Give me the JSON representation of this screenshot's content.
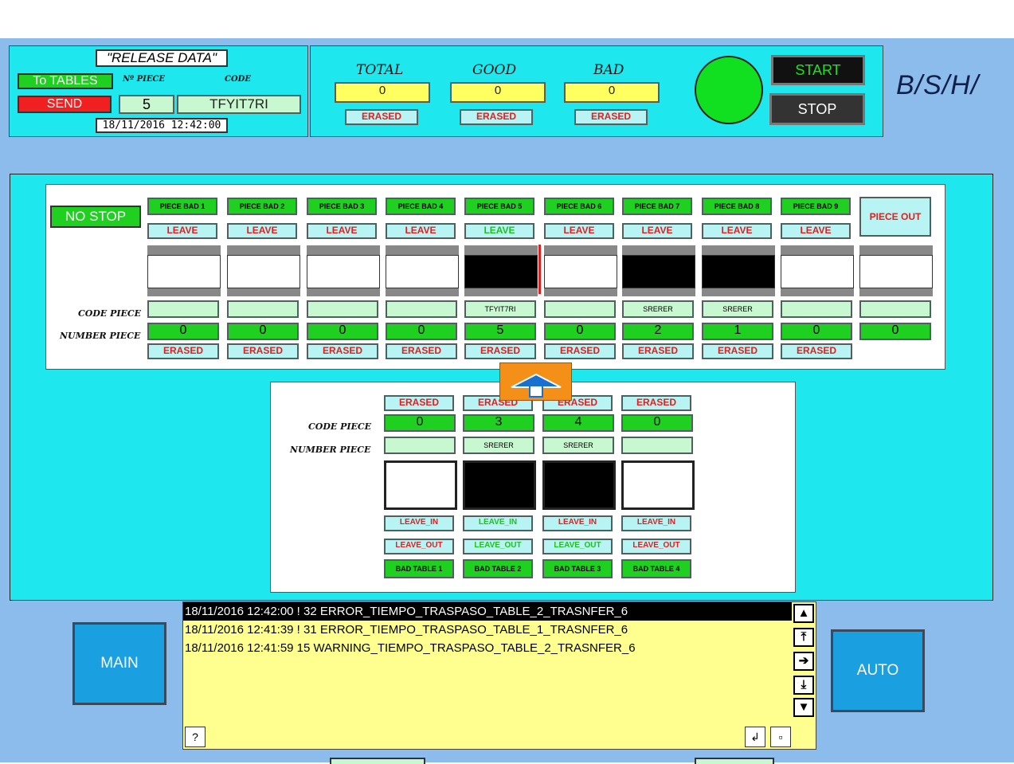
{
  "release": {
    "title": "\"RELEASE DATA\"",
    "to_tables_label": "To TABLES",
    "send_label": "SEND",
    "piece_no_label": "Nº PIECE",
    "code_label": "CODE",
    "piece_no_value": "5",
    "code_value": "TFYIT7RI",
    "datetime": "18/11/2016 12:42:00"
  },
  "counters": {
    "total_label": "TOTAL",
    "good_label": "GOOD",
    "bad_label": "BAD",
    "total_value": "0",
    "good_value": "0",
    "bad_value": "0",
    "erased_label": "ERASED"
  },
  "controls": {
    "start_label": "START",
    "stop_label": "STOP",
    "status_color": "#10e020"
  },
  "logo": "B/S/H/",
  "tables": {
    "no_stop_label": "NO STOP",
    "piece_out_label": "PIECE OUT",
    "code_piece_label": "CODE PIECE",
    "number_piece_label": "NUMBER PIECE",
    "erased_label": "ERASED",
    "columns": [
      {
        "bad_label": "PIECE BAD 1",
        "leave_label": "LEAVE",
        "slot": "empty",
        "code": "",
        "number": "0"
      },
      {
        "bad_label": "PIECE BAD 2",
        "leave_label": "LEAVE",
        "slot": "empty",
        "code": "",
        "number": "0"
      },
      {
        "bad_label": "PIECE BAD 3",
        "leave_label": "LEAVE",
        "slot": "empty",
        "code": "",
        "number": "0"
      },
      {
        "bad_label": "PIECE BAD 4",
        "leave_label": "LEAVE",
        "slot": "empty",
        "code": "",
        "number": "0"
      },
      {
        "bad_label": "PIECE BAD 5",
        "leave_label": "LEAVE",
        "slot": "occupied",
        "code": "TFYIT7RI",
        "number": "5"
      },
      {
        "bad_label": "PIECE BAD 6",
        "leave_label": "LEAVE",
        "slot": "empty",
        "code": "",
        "number": "0"
      },
      {
        "bad_label": "PIECE BAD 7",
        "leave_label": "LEAVE",
        "slot": "occupied",
        "code": "SRERER",
        "number": "2"
      },
      {
        "bad_label": "PIECE BAD 8",
        "leave_label": "LEAVE",
        "slot": "occupied",
        "code": "SRERER",
        "number": "1"
      },
      {
        "bad_label": "PIECE BAD 9",
        "leave_label": "LEAVE",
        "slot": "empty",
        "code": "",
        "number": "0"
      },
      {
        "bad_label": "",
        "leave_label": "",
        "slot": "empty",
        "code": "",
        "number": "0"
      }
    ]
  },
  "bad_tables": {
    "code_piece_label": "CODE PIECE",
    "number_piece_label": "NUMBER PIECE",
    "erased_label": "ERASED",
    "leave_in_label": "LEAVE_IN",
    "leave_out_label": "LEAVE_OUT",
    "columns": [
      {
        "number": "0",
        "code": "",
        "slot": "empty",
        "table_label": "BAD TABLE 1"
      },
      {
        "number": "3",
        "code": "SRERER",
        "slot": "occupied",
        "table_label": "BAD TABLE 2"
      },
      {
        "number": "4",
        "code": "SRERER",
        "slot": "occupied",
        "table_label": "BAD TABLE 3"
      },
      {
        "number": "0",
        "code": "",
        "slot": "empty",
        "table_label": "BAD TABLE 4"
      }
    ]
  },
  "nav": {
    "main_label": "MAIN",
    "auto_label": "AUTO"
  },
  "alarms": {
    "lines": [
      "18/11/2016 12:42:00 ! 32 ERROR_TIEMPO_TRASPASO_TABLE_2_TRASNFER_6",
      "18/11/2016 12:41:39 ! 31 ERROR_TIEMPO_TRASPASO_TABLE_1_TRASNFER_6",
      "18/11/2016 12:41:59  15 WARNING_TIEMPO_TRASPASO_TABLE_2_TRASNFER_6"
    ],
    "help_label": "?",
    "scroll_icons": [
      "arrow-up-icon",
      "page-up-icon",
      "arrow-right-icon",
      "page-down-icon",
      "arrow-down-icon"
    ]
  }
}
